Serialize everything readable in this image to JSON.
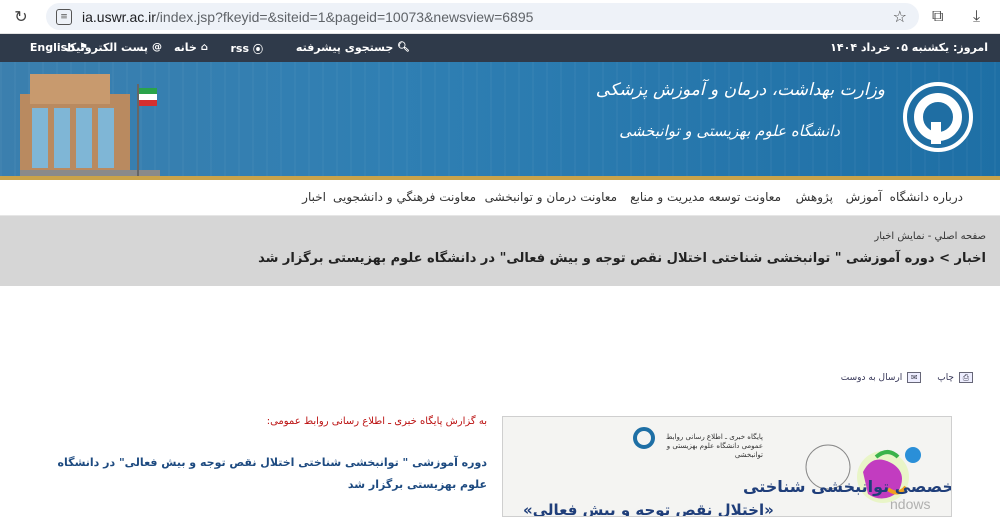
{
  "browser": {
    "url_host": "ia.uswr.ac.ir",
    "url_path": "/index.jsp?fkeyid=&siteid=1&pageid=10073&newsview=6895"
  },
  "topbar": {
    "date": "امروز: يكشنبه ۰۵ خرداد ۱۴۰۴",
    "advanced_search": "جستجوی پیشرفته",
    "rss": "rss",
    "home": "خانه",
    "email": "پست الکترونیک",
    "english": "English"
  },
  "banner": {
    "ministry": "وزارت بهداشت، درمان و آموزش پزشکی",
    "university": "دانشگاه علوم بهزیستی و توانبخشی"
  },
  "nav": {
    "items": [
      "درباره دانشگاه",
      "آموزش",
      "پژوهش",
      "معاونت توسعه مدیریت و منابع",
      "معاونت درمان و توانبخشی",
      "معاونت فرهنگي و دانشجويی",
      "اخبار"
    ]
  },
  "breadcrumb": {
    "home": "صفحه اصلي",
    "sep": "-",
    "current": "نمایش اخبار",
    "title": "اخبار > دوره آموزشی \" توانبخشی شناختی اختلال نقص توجه و بیش فعالی\" در دانشگاه علوم بهزیستی برگزار شد"
  },
  "tools": {
    "print": "چاپ",
    "send": "ارسال به دوست"
  },
  "article": {
    "source": "به گزارش پایگاه خبری ـ اطلاع رسانی روابط عمومی:",
    "lead": "دوره آموزشی \" توانبخشی شناختی اختلال نقص توجه و بیش فعالی\" در دانشگاه علوم بهزیستی برگزار شد"
  },
  "poster": {
    "org": "پایگاه خبری ـ اطلاع رسانی روابط عمومی دانشگاه علوم بهزیستی و توانبخشی",
    "line1": "دوره تخصصی توانبخشی شناختی",
    "line2": "«اختلال نقص توجه و بیش فعالی»"
  },
  "watermark": "ndows"
}
